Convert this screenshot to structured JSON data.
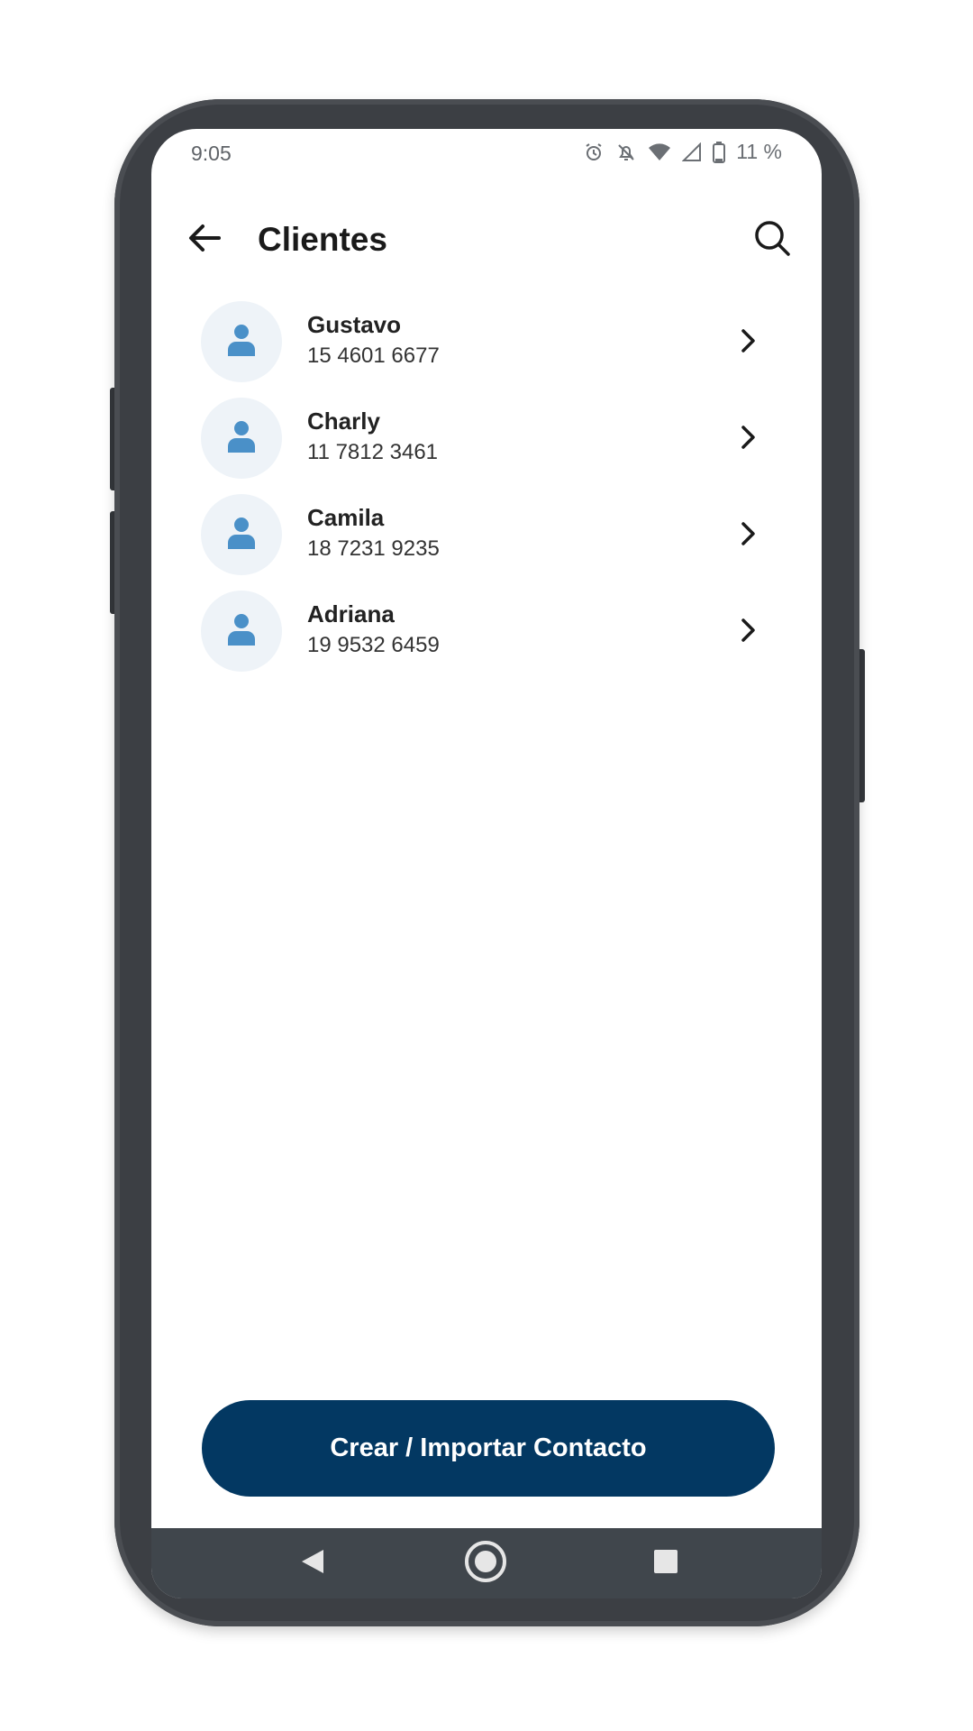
{
  "status_bar": {
    "time": "9:05",
    "battery_text": "11 %",
    "icons": [
      "alarm-icon",
      "notifications-off-icon",
      "wifi-icon",
      "signal-icon",
      "battery-icon"
    ]
  },
  "header": {
    "title": "Clientes",
    "back_icon": "arrow-left-icon",
    "search_icon": "search-icon"
  },
  "contacts": [
    {
      "name": "Gustavo",
      "phone": "15 4601 6677"
    },
    {
      "name": "Charly",
      "phone": "11 7812 3461"
    },
    {
      "name": "Camila",
      "phone": "18 7231 9235"
    },
    {
      "name": "Adriana",
      "phone": "19 9532 6459"
    }
  ],
  "actions": {
    "create_import_label": "Crear / Importar Contacto"
  },
  "nav_bar": {
    "icons": [
      "nav-back-icon",
      "nav-home-icon",
      "nav-recents-icon"
    ]
  },
  "colors": {
    "primary": "#033862",
    "avatar_bg": "#eef3f8",
    "avatar_icon": "#4a90c8",
    "frame": "#3c3f44",
    "nav_bar": "#40464c"
  }
}
